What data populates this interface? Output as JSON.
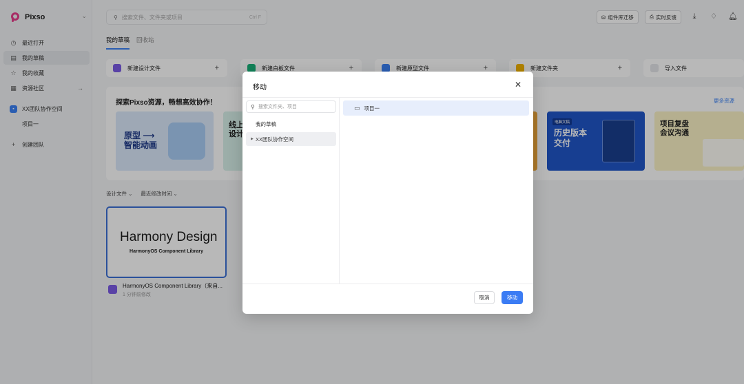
{
  "app": {
    "name": "Pixso"
  },
  "sidebar": {
    "items": [
      {
        "label": "最近打开",
        "icon": "clock-icon"
      },
      {
        "label": "我的草稿",
        "icon": "draft-icon"
      },
      {
        "label": "我的收藏",
        "icon": "star-icon"
      },
      {
        "label": "资源社区",
        "icon": "grid-icon"
      }
    ],
    "team": {
      "label": "XX团队协作空间",
      "badge": "▪"
    },
    "project": "项目一",
    "create_team": "创建团队"
  },
  "topbar": {
    "search_placeholder": "搜索文件、文件夹或项目",
    "search_shortcut": "Ctrl F",
    "btn_migrate": "组件库迁移",
    "btn_feedback": "实时反馈"
  },
  "main": {
    "tabs": [
      "我的草稿",
      "回收站"
    ],
    "new_cards": [
      {
        "label": "新建设计文件",
        "color": "#7c5ce6"
      },
      {
        "label": "新建白板文件",
        "color": "#19b37a"
      },
      {
        "label": "新建原型文件",
        "color": "#3b82f6"
      },
      {
        "label": "新建文件夹",
        "color": "#f4b400"
      },
      {
        "label": "导入文件",
        "color": "#e5e7eb"
      }
    ],
    "banner_title": "探索Pixso资源，畅想高效协作！",
    "banner_more": "更多资源",
    "resources": [
      {
        "title": "原型 ⟶\n智能动画"
      },
      {
        "title": "线上\n设计"
      },
      {
        "tag": "电脑文稿",
        "title": "历史版本\n交付"
      },
      {
        "title": "项目复盘\n会议沟通"
      }
    ],
    "filters": [
      "设计文件 ⌄",
      "最近修改时间 ⌄"
    ],
    "file": {
      "thumb_title": "Harmony Design",
      "thumb_sub": "HarmonyOS Component Library",
      "name": "HarmonyOS Component Library（来自...",
      "time": "1 分钟前修改"
    }
  },
  "modal": {
    "title": "移动",
    "search_placeholder": "搜索文件夹、项目",
    "tree": [
      "我的草稿",
      "XX团队协作空间"
    ],
    "folder": "项目一",
    "cancel": "取消",
    "confirm": "移动"
  }
}
